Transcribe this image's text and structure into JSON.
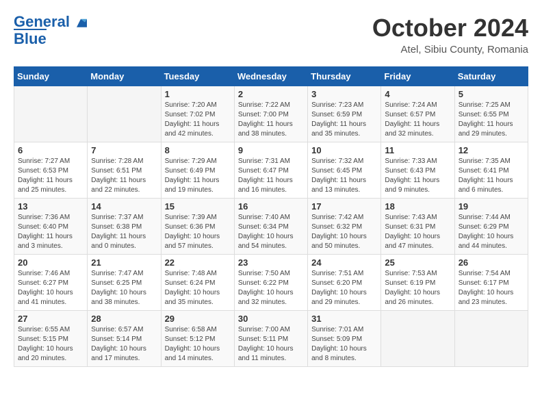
{
  "header": {
    "logo_line1": "General",
    "logo_line2": "Blue",
    "month": "October 2024",
    "location": "Atel, Sibiu County, Romania"
  },
  "weekdays": [
    "Sunday",
    "Monday",
    "Tuesday",
    "Wednesday",
    "Thursday",
    "Friday",
    "Saturday"
  ],
  "weeks": [
    [
      {
        "day": "",
        "info": ""
      },
      {
        "day": "",
        "info": ""
      },
      {
        "day": "1",
        "info": "Sunrise: 7:20 AM\nSunset: 7:02 PM\nDaylight: 11 hours and 42 minutes."
      },
      {
        "day": "2",
        "info": "Sunrise: 7:22 AM\nSunset: 7:00 PM\nDaylight: 11 hours and 38 minutes."
      },
      {
        "day": "3",
        "info": "Sunrise: 7:23 AM\nSunset: 6:59 PM\nDaylight: 11 hours and 35 minutes."
      },
      {
        "day": "4",
        "info": "Sunrise: 7:24 AM\nSunset: 6:57 PM\nDaylight: 11 hours and 32 minutes."
      },
      {
        "day": "5",
        "info": "Sunrise: 7:25 AM\nSunset: 6:55 PM\nDaylight: 11 hours and 29 minutes."
      }
    ],
    [
      {
        "day": "6",
        "info": "Sunrise: 7:27 AM\nSunset: 6:53 PM\nDaylight: 11 hours and 25 minutes."
      },
      {
        "day": "7",
        "info": "Sunrise: 7:28 AM\nSunset: 6:51 PM\nDaylight: 11 hours and 22 minutes."
      },
      {
        "day": "8",
        "info": "Sunrise: 7:29 AM\nSunset: 6:49 PM\nDaylight: 11 hours and 19 minutes."
      },
      {
        "day": "9",
        "info": "Sunrise: 7:31 AM\nSunset: 6:47 PM\nDaylight: 11 hours and 16 minutes."
      },
      {
        "day": "10",
        "info": "Sunrise: 7:32 AM\nSunset: 6:45 PM\nDaylight: 11 hours and 13 minutes."
      },
      {
        "day": "11",
        "info": "Sunrise: 7:33 AM\nSunset: 6:43 PM\nDaylight: 11 hours and 9 minutes."
      },
      {
        "day": "12",
        "info": "Sunrise: 7:35 AM\nSunset: 6:41 PM\nDaylight: 11 hours and 6 minutes."
      }
    ],
    [
      {
        "day": "13",
        "info": "Sunrise: 7:36 AM\nSunset: 6:40 PM\nDaylight: 11 hours and 3 minutes."
      },
      {
        "day": "14",
        "info": "Sunrise: 7:37 AM\nSunset: 6:38 PM\nDaylight: 11 hours and 0 minutes."
      },
      {
        "day": "15",
        "info": "Sunrise: 7:39 AM\nSunset: 6:36 PM\nDaylight: 10 hours and 57 minutes."
      },
      {
        "day": "16",
        "info": "Sunrise: 7:40 AM\nSunset: 6:34 PM\nDaylight: 10 hours and 54 minutes."
      },
      {
        "day": "17",
        "info": "Sunrise: 7:42 AM\nSunset: 6:32 PM\nDaylight: 10 hours and 50 minutes."
      },
      {
        "day": "18",
        "info": "Sunrise: 7:43 AM\nSunset: 6:31 PM\nDaylight: 10 hours and 47 minutes."
      },
      {
        "day": "19",
        "info": "Sunrise: 7:44 AM\nSunset: 6:29 PM\nDaylight: 10 hours and 44 minutes."
      }
    ],
    [
      {
        "day": "20",
        "info": "Sunrise: 7:46 AM\nSunset: 6:27 PM\nDaylight: 10 hours and 41 minutes."
      },
      {
        "day": "21",
        "info": "Sunrise: 7:47 AM\nSunset: 6:25 PM\nDaylight: 10 hours and 38 minutes."
      },
      {
        "day": "22",
        "info": "Sunrise: 7:48 AM\nSunset: 6:24 PM\nDaylight: 10 hours and 35 minutes."
      },
      {
        "day": "23",
        "info": "Sunrise: 7:50 AM\nSunset: 6:22 PM\nDaylight: 10 hours and 32 minutes."
      },
      {
        "day": "24",
        "info": "Sunrise: 7:51 AM\nSunset: 6:20 PM\nDaylight: 10 hours and 29 minutes."
      },
      {
        "day": "25",
        "info": "Sunrise: 7:53 AM\nSunset: 6:19 PM\nDaylight: 10 hours and 26 minutes."
      },
      {
        "day": "26",
        "info": "Sunrise: 7:54 AM\nSunset: 6:17 PM\nDaylight: 10 hours and 23 minutes."
      }
    ],
    [
      {
        "day": "27",
        "info": "Sunrise: 6:55 AM\nSunset: 5:15 PM\nDaylight: 10 hours and 20 minutes."
      },
      {
        "day": "28",
        "info": "Sunrise: 6:57 AM\nSunset: 5:14 PM\nDaylight: 10 hours and 17 minutes."
      },
      {
        "day": "29",
        "info": "Sunrise: 6:58 AM\nSunset: 5:12 PM\nDaylight: 10 hours and 14 minutes."
      },
      {
        "day": "30",
        "info": "Sunrise: 7:00 AM\nSunset: 5:11 PM\nDaylight: 10 hours and 11 minutes."
      },
      {
        "day": "31",
        "info": "Sunrise: 7:01 AM\nSunset: 5:09 PM\nDaylight: 10 hours and 8 minutes."
      },
      {
        "day": "",
        "info": ""
      },
      {
        "day": "",
        "info": ""
      }
    ]
  ]
}
